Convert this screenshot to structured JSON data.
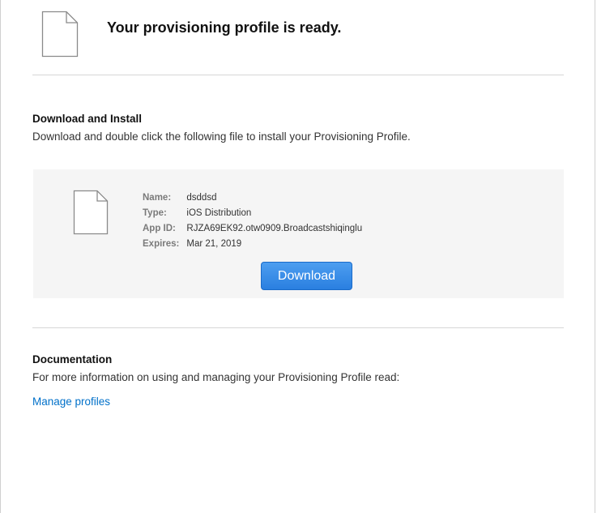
{
  "header": {
    "icon": "document-icon",
    "title": "Your provisioning profile is ready."
  },
  "download_section": {
    "heading": "Download and Install",
    "description": "Download and double click the following file to install your Provisioning Profile."
  },
  "profile": {
    "icon": "document-icon",
    "fields": [
      {
        "label": "Name:",
        "value": "dsddsd"
      },
      {
        "label": "Type:",
        "value": "iOS Distribution"
      },
      {
        "label": "App ID:",
        "value": "RJZA69EK92.otw0909.Broadcastshiqinglu"
      },
      {
        "label": "Expires:",
        "value": "Mar 21, 2019"
      }
    ],
    "download_label": "Download"
  },
  "documentation": {
    "heading": "Documentation",
    "description": "For more information on using and managing your Provisioning Profile read:",
    "link_label": "Manage profiles"
  },
  "colors": {
    "accent": "#2a7fe0",
    "link": "#0070c9",
    "panel": "#f5f5f5"
  }
}
